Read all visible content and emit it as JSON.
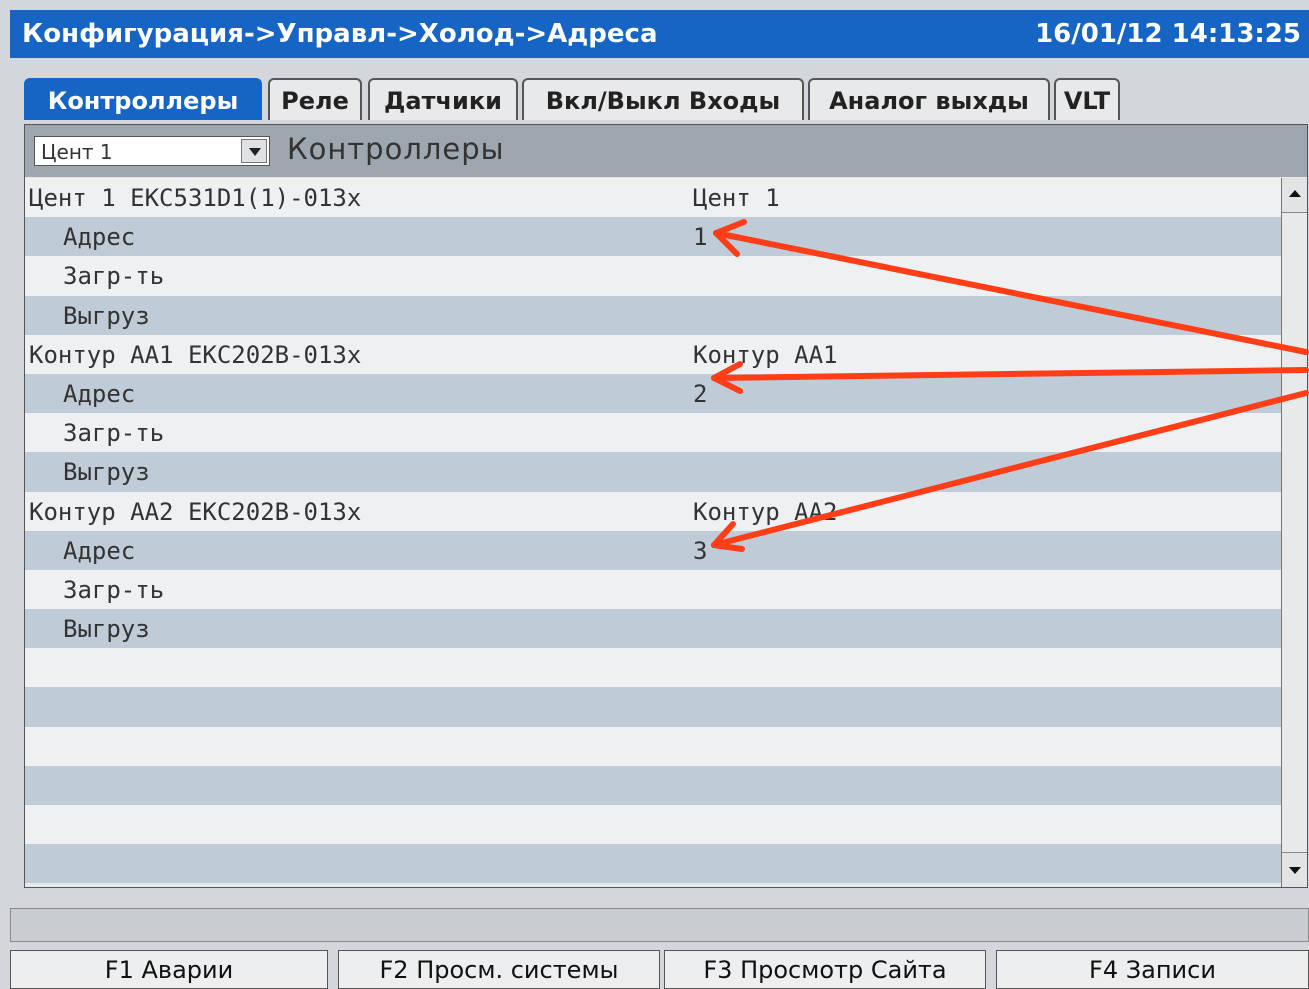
{
  "title": {
    "path": "Конфигурация->Управл->Холод->Адреса",
    "datetime": "16/01/12 14:13:25"
  },
  "tabs": [
    {
      "label": "Контроллеры",
      "active": true
    },
    {
      "label": "Реле",
      "active": false
    },
    {
      "label": "Датчики",
      "active": false
    },
    {
      "label": "Вкл/Выкл Входы",
      "active": false
    },
    {
      "label": "Аналог выхды",
      "active": false
    },
    {
      "label": "VLT",
      "active": false
    }
  ],
  "panel": {
    "selector_value": "Цент 1",
    "section_title": "Контроллеры",
    "rows": [
      {
        "name": "Цент 1 EKC531D1(1)-013x",
        "value": "Цент 1",
        "sub": false
      },
      {
        "name": "Адрес",
        "value": "1",
        "sub": true
      },
      {
        "name": "Загр-ть",
        "value": "",
        "sub": true
      },
      {
        "name": "Выгруз",
        "value": "",
        "sub": true
      },
      {
        "name": "Контур AA1 EKC202B-013x",
        "value": "Контур AA1",
        "sub": false
      },
      {
        "name": "Адрес",
        "value": "2",
        "sub": true
      },
      {
        "name": "Загр-ть",
        "value": "",
        "sub": true
      },
      {
        "name": "Выгруз",
        "value": "",
        "sub": true
      },
      {
        "name": "Контур AA2 EKC202B-013x",
        "value": "Контур AA2",
        "sub": false
      },
      {
        "name": "Адрес",
        "value": "3",
        "sub": true
      },
      {
        "name": "Загр-ть",
        "value": "",
        "sub": true
      },
      {
        "name": "Выгруз",
        "value": "",
        "sub": true
      },
      {
        "name": "",
        "value": "",
        "sub": false
      },
      {
        "name": "",
        "value": "",
        "sub": false
      },
      {
        "name": "",
        "value": "",
        "sub": false
      },
      {
        "name": "",
        "value": "",
        "sub": false
      },
      {
        "name": "",
        "value": "",
        "sub": false
      },
      {
        "name": "",
        "value": "",
        "sub": false
      }
    ]
  },
  "function_keys": [
    {
      "label": "F1 Аварии"
    },
    {
      "label": "F2 Просм. системы"
    },
    {
      "label": "F3 Просмотр Сайта"
    },
    {
      "label": "F4 Записи"
    }
  ],
  "colors": {
    "title_bar": "#1665c4",
    "row_alt": "#bfcbd7",
    "annotation_arrow": "#ff3d17"
  }
}
